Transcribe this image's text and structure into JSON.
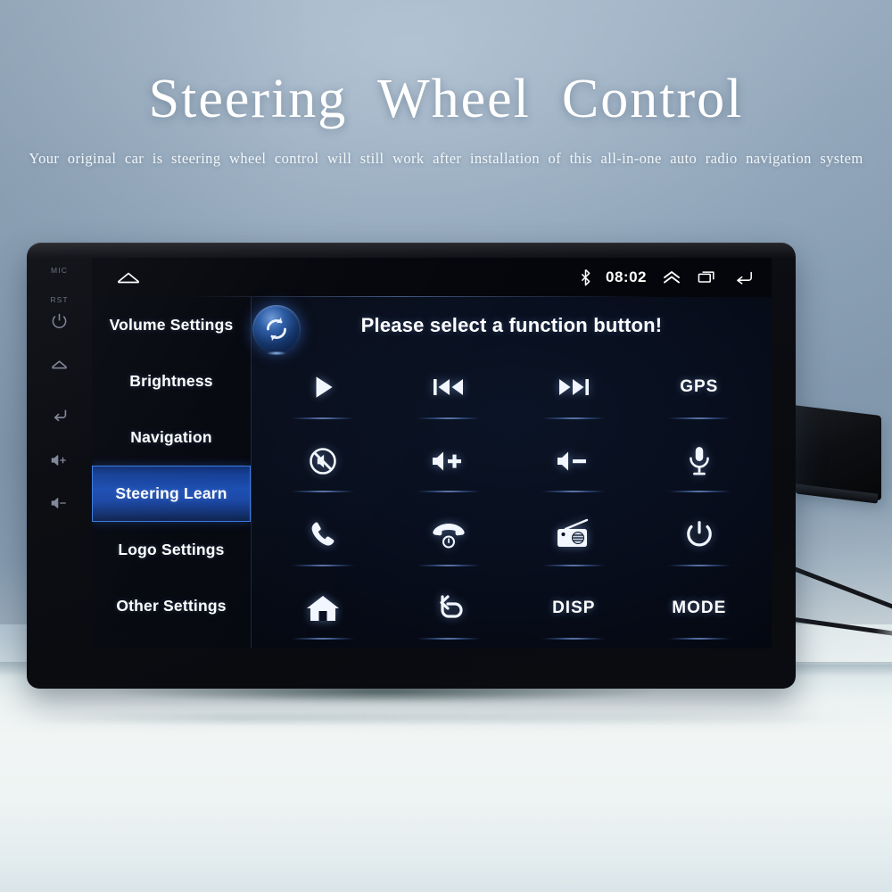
{
  "hero": {
    "title": "Steering  Wheel  Control",
    "subtitle": "Your original car is steering wheel control will still work after installation of this all-in-one auto radio navigation system"
  },
  "device": {
    "bezel_buttons": [
      {
        "name": "mic-label",
        "label": "MIC",
        "type": "text"
      },
      {
        "name": "reset-label",
        "label": "RST",
        "type": "text"
      },
      {
        "name": "power-button",
        "label": "",
        "type": "icon",
        "icon": "power-icon"
      },
      {
        "name": "home-button",
        "label": "",
        "type": "icon",
        "icon": "home-icon"
      },
      {
        "name": "back-button",
        "label": "",
        "type": "icon",
        "icon": "back-arrow-icon"
      },
      {
        "name": "volume-up-button",
        "label": "",
        "type": "icon",
        "icon": "volume-up-icon"
      },
      {
        "name": "volume-down-button",
        "label": "",
        "type": "icon",
        "icon": "volume-down-icon"
      }
    ]
  },
  "statusbar": {
    "home_icon": "home-icon",
    "bluetooth_icon": "bluetooth-icon",
    "time": "08:02",
    "expand_icon": "double-chevron-up-icon",
    "recents_icon": "recent-apps-icon",
    "back_icon": "back-arrow-icon"
  },
  "sidebar": {
    "items": [
      {
        "label": "Volume Settings",
        "active": false
      },
      {
        "label": "Brightness",
        "active": false
      },
      {
        "label": "Navigation",
        "active": false
      },
      {
        "label": "Steering Learn",
        "active": true
      },
      {
        "label": "Logo Settings",
        "active": false
      },
      {
        "label": "Other Settings",
        "active": false
      }
    ]
  },
  "panel": {
    "sync_icon": "sync-refresh-icon",
    "title": "Please select a function button!",
    "functions": [
      {
        "label": "",
        "icon": "play-icon",
        "kind": "icon"
      },
      {
        "label": "",
        "icon": "previous-track-icon",
        "kind": "icon"
      },
      {
        "label": "",
        "icon": "next-track-icon",
        "kind": "icon"
      },
      {
        "label": "GPS",
        "icon": "",
        "kind": "text"
      },
      {
        "label": "",
        "icon": "mute-icon",
        "kind": "icon"
      },
      {
        "label": "",
        "icon": "volume-up-icon",
        "kind": "icon"
      },
      {
        "label": "",
        "icon": "volume-down-icon",
        "kind": "icon"
      },
      {
        "label": "",
        "icon": "microphone-icon",
        "kind": "icon"
      },
      {
        "label": "",
        "icon": "phone-answer-icon",
        "kind": "icon"
      },
      {
        "label": "",
        "icon": "phone-hangup-icon",
        "kind": "icon"
      },
      {
        "label": "",
        "icon": "radio-icon",
        "kind": "icon"
      },
      {
        "label": "",
        "icon": "power-icon",
        "kind": "icon"
      },
      {
        "label": "",
        "icon": "home-icon",
        "kind": "icon"
      },
      {
        "label": "",
        "icon": "return-arrow-icon",
        "kind": "icon"
      },
      {
        "label": "DISP",
        "icon": "",
        "kind": "text"
      },
      {
        "label": "MODE",
        "icon": "",
        "kind": "text"
      }
    ]
  },
  "colors": {
    "accent_blue": "#1b4db2",
    "highlight_border": "#3b7ae0",
    "screen_bg": "#04060c",
    "text_white": "#ffffff"
  }
}
